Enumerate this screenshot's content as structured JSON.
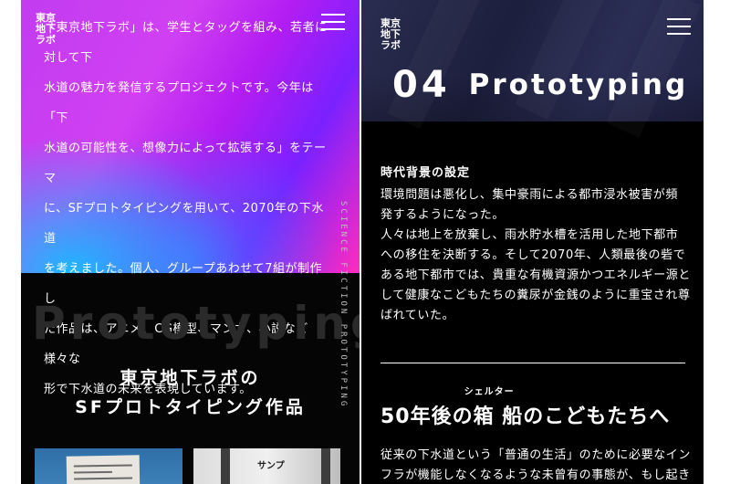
{
  "left": {
    "brand": [
      "東京",
      "地下",
      "ラボ"
    ],
    "intro_lines": [
      "「東京地下ラボ」は、学生とタッグを組み、若者に対して下",
      "水道の魅力を発信するプロジェクトです。今年は「下",
      "水道の可能性を、想像力によって拡張する」をテーマ",
      "に、SFプロトタイピングを用いて、2070年の下水道",
      "を考えました。個人、グループあわせて7組が制作し",
      "た作品は、アニメ、CG模型、マンガ、小説など様々な",
      "形で下水道の未来を表現しています。"
    ],
    "ghost_title": "Prototyping",
    "works_title": [
      "東京地下ラボの",
      "SFプロトタイピング作品"
    ],
    "vertical_label": "SCIENCE FICTION PROTOTYPING",
    "thumb2_text": "サンプ"
  },
  "right": {
    "brand": [
      "東京",
      "地下",
      "ラボ"
    ],
    "chapter_num": "04",
    "chapter_name": "Prototyping",
    "section_head": "時代背景の設定",
    "para_lines": [
      "環境問題は悪化し、集中豪雨による都市浸水被害が頻",
      "発するようになった。",
      "人々は地上を放棄し、雨水貯水槽を活用した地下都市",
      "への移住を決断する。そして2070年、人類最後の砦で",
      "ある地下都市では、貴重な有機資源かつエネルギー源と",
      "して健康なこどもたちの糞尿が金銭のように重宝され尊",
      "ばれていた。"
    ],
    "big_head_before": "50年後の",
    "big_head_ruby_base": "箱 船",
    "big_head_ruby": "シェルター",
    "big_head_after": "のこどもたちへ",
    "para2_lines": [
      "従来の下水道という「普通の生活」のために必要なイン",
      "フラが機能しなくなるような未曾有の事態が、もし起きて"
    ]
  }
}
